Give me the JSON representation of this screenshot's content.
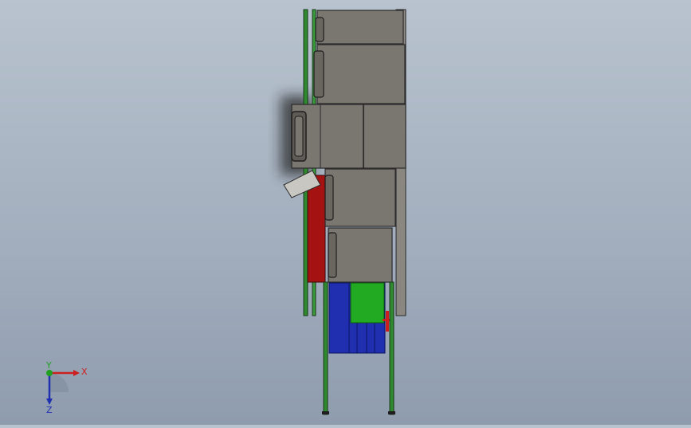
{
  "viewport": {
    "background_top": "#b9c3cf",
    "background_bottom": "#8f9cae"
  },
  "model": {
    "colors": {
      "housing": "#7a7670",
      "housing_edge": "#2b2b2b",
      "frame_green": "#2f8a2f",
      "red_panel": "#a51212",
      "blue_motor": "#1f2fb0",
      "green_block": "#22aa22",
      "light_plate": "#c9c7c2"
    }
  },
  "triad": {
    "x_label": "X",
    "y_label": "Y",
    "z_label": "Z",
    "x_color": "#cc2020",
    "y_color": "#20a020",
    "z_color": "#2030b0"
  }
}
